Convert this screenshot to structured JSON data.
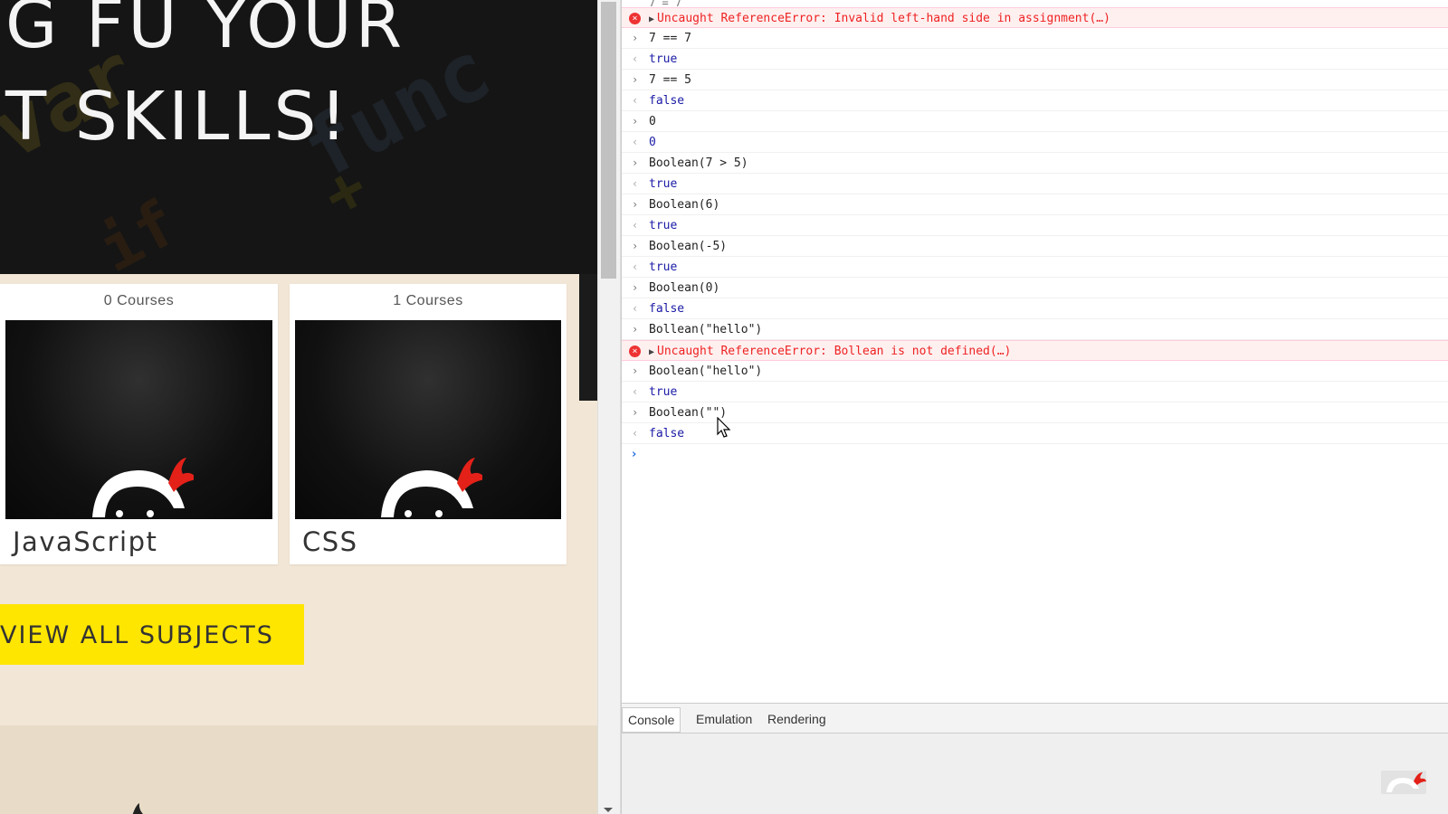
{
  "hero": {
    "line1": "G FU YOUR",
    "line2": "T SKILLS!"
  },
  "courses": [
    {
      "count": "0 Courses",
      "name": "JavaScript"
    },
    {
      "count": "1 Courses",
      "name": "CSS"
    }
  ],
  "view_all_label": "VIEW ALL SUBJECTS",
  "console": {
    "top_cutoff": "7 = 7",
    "rows": [
      {
        "kind": "err",
        "text": "Uncaught ReferenceError: Invalid left-hand side in assignment(…)"
      },
      {
        "kind": "in",
        "text": "7 == 7"
      },
      {
        "kind": "out",
        "text": "true"
      },
      {
        "kind": "in",
        "text": "7 == 5"
      },
      {
        "kind": "out",
        "text": "false"
      },
      {
        "kind": "in",
        "text": "0"
      },
      {
        "kind": "out",
        "text": "0"
      },
      {
        "kind": "in",
        "text": "Boolean(7 > 5)"
      },
      {
        "kind": "out",
        "text": "true"
      },
      {
        "kind": "in",
        "text": "Boolean(6)"
      },
      {
        "kind": "out",
        "text": "true"
      },
      {
        "kind": "in",
        "text": "Boolean(-5)"
      },
      {
        "kind": "out",
        "text": "true"
      },
      {
        "kind": "in",
        "text": "Boolean(0)"
      },
      {
        "kind": "out",
        "text": "false"
      },
      {
        "kind": "in",
        "text": "Bollean(\"hello\")"
      },
      {
        "kind": "err",
        "text": "Uncaught ReferenceError: Bollean is not defined(…)"
      },
      {
        "kind": "in",
        "text": "Boolean(\"hello\")"
      },
      {
        "kind": "out",
        "text": "true"
      },
      {
        "kind": "in",
        "text": "Boolean(\"\")"
      },
      {
        "kind": "out",
        "text": "false"
      }
    ]
  },
  "drawer_tabs": [
    "Console",
    "Emulation",
    "Rendering"
  ],
  "colors": {
    "accent_yellow": "#ffe600",
    "error_red": "#e22222",
    "output_blue": "#1a1aa6",
    "page_beige": "#f2e6d6"
  },
  "icons": {
    "error": "error-circle-icon",
    "input_prefix": "chevron-right-icon",
    "output_prefix": "chevron-left-icon",
    "expand": "triangle-right-icon"
  }
}
